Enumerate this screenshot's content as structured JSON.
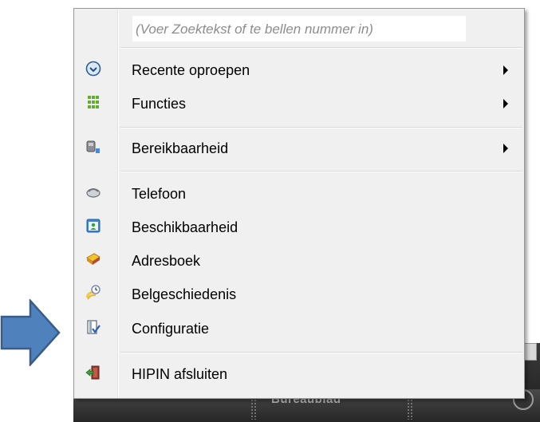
{
  "menu": {
    "search_placeholder": "(Voer Zoektekst of te bellen nummer in)",
    "items": [
      {
        "label": "Recente oproepen",
        "icon": "clock-icon",
        "submenu": true
      },
      {
        "label": "Functies",
        "icon": "grid-icon",
        "submenu": true
      },
      {
        "label": "Bereikbaarheid",
        "icon": "reachability-icon",
        "submenu": true
      },
      {
        "label": "Telefoon",
        "icon": "phone-icon",
        "submenu": false
      },
      {
        "label": "Beschikbaarheid",
        "icon": "availability-icon",
        "submenu": false
      },
      {
        "label": "Adresboek",
        "icon": "address-book-icon",
        "submenu": false
      },
      {
        "label": "Belgeschiedenis",
        "icon": "call-history-icon",
        "submenu": false
      },
      {
        "label": "Configuratie",
        "icon": "configuration-icon",
        "submenu": false
      },
      {
        "label": "HIPIN afsluiten",
        "icon": "exit-icon",
        "submenu": false
      }
    ]
  },
  "taskbar": {
    "label": "Bureaublad"
  },
  "colors": {
    "pointer_fill": "#4f81bd",
    "pointer_stroke": "#385d8a",
    "menu_background": "#f0f0f0"
  }
}
